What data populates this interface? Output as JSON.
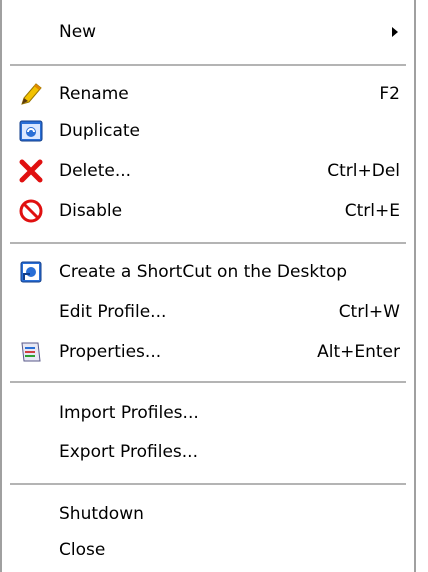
{
  "menu": {
    "items": [
      {
        "label": "New",
        "shortcut": "",
        "icon": "",
        "submenu": true
      },
      {
        "label": "Rename",
        "shortcut": "F2",
        "icon": "pencil-icon"
      },
      {
        "label": "Duplicate",
        "shortcut": "",
        "icon": "duplicate-icon"
      },
      {
        "label": "Delete...",
        "shortcut": "Ctrl+Del",
        "icon": "delete-x-icon"
      },
      {
        "label": "Disable",
        "shortcut": "Ctrl+E",
        "icon": "disable-icon"
      },
      {
        "label": "Create a ShortCut on the Desktop",
        "shortcut": "",
        "icon": "shortcut-icon"
      },
      {
        "label": "Edit Profile...",
        "shortcut": "Ctrl+W",
        "icon": ""
      },
      {
        "label": "Properties...",
        "shortcut": "Alt+Enter",
        "icon": "properties-icon"
      },
      {
        "label": "Import Profiles...",
        "shortcut": "",
        "icon": ""
      },
      {
        "label": "Export Profiles...",
        "shortcut": "",
        "icon": ""
      },
      {
        "label": "Shutdown",
        "shortcut": "",
        "icon": ""
      },
      {
        "label": "Close",
        "shortcut": "",
        "icon": ""
      }
    ]
  },
  "colors": {
    "separator": "#b4b4b4",
    "border": "#a0a0a0",
    "delete_red": "#e01010",
    "pencil_yellow": "#f2c200",
    "icon_blue": "#2a6fd6"
  }
}
